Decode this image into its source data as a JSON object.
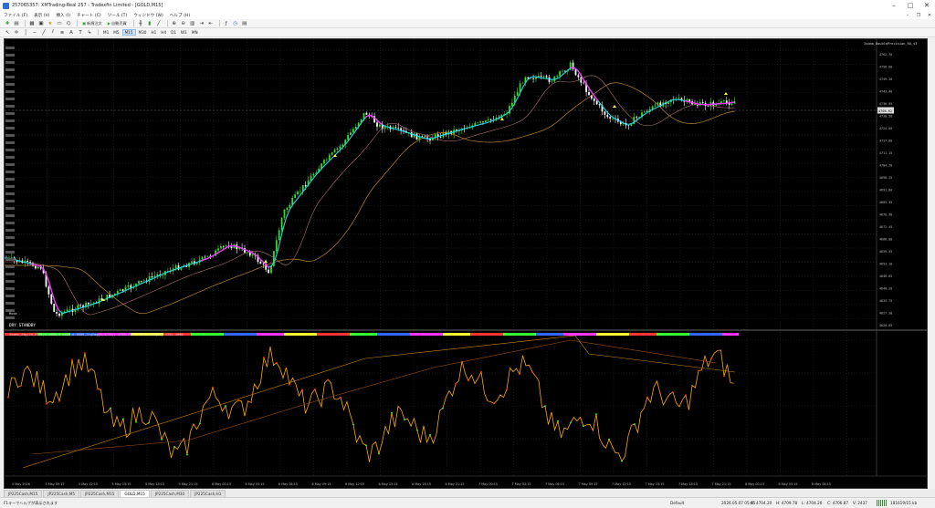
{
  "window": {
    "title": "257065357: XMTrading-Real 257 - Tradexfin Limited - [GOLD,M15]"
  },
  "menu": {
    "items": [
      "ファイル (F)",
      "表示 (V)",
      "挿入 (I)",
      "チャート (C)",
      "ツール (T)",
      "ウィンドウ (W)",
      "ヘルプ (H)"
    ]
  },
  "toolbar": {
    "new_order_label": "新規注文",
    "autotrade_label": "自動売買",
    "timeframes": [
      "M1",
      "M5",
      "M15",
      "M30",
      "H1",
      "H4",
      "D1",
      "W1",
      "MN"
    ],
    "active_timeframe": "M15"
  },
  "chart": {
    "indicator_name": "Ivoma_DoublePrecision_RA_v3",
    "sub_label": "DRY STANDBY",
    "mode_label": "Mode -",
    "lower_indicator": "Ivoma_Zag(20,0.01,0.0000,0.0000,0.0000,ZigZag(5,3,12)) 4733.7784 4758.1620(15) 4752.3990",
    "price_levels": [
      "4762.70",
      "4756.60",
      "4749.10",
      "4743.40",
      "4736.95",
      "4730.50",
      "4724.05",
      "4717.60",
      "4711.15",
      "4704.70",
      "4698.25",
      "4691.80",
      "4685.35",
      "4678.90",
      "4672.45",
      "4666.00",
      "4659.55",
      "4653.10",
      "4646.65",
      "4640.20",
      "4633.75",
      "4627.30",
      "4620.85"
    ],
    "current_price": "4705.62",
    "time_labels": [
      "5 May 2026",
      "5 May 09:15",
      "5 May 12:15",
      "5 May 15:15",
      "5 May 18:15",
      "5 May 21:15",
      "6 May 00:15",
      "6 May 03:15",
      "6 May 06:15",
      "6 May 09:15",
      "6 May 12:15",
      "6 May 15:15",
      "6 May 18:15",
      "6 May 21:15",
      "7 May 00:15",
      "7 May 03:15",
      "7 May 06:15",
      "7 May 09:15",
      "7 May 12:15",
      "7 May 15:15",
      "7 May 18:15",
      "7 May 21:15",
      "8 May 00:15",
      "8 May 03:15",
      "8 May 06:15"
    ],
    "colors": {
      "background": "#000000",
      "bull": "#33dd22",
      "bear": "#ffffff",
      "ma_fast": "#22d8e8",
      "ma_signal": "#ff33ff",
      "ma_slow": "#b8862b",
      "osc": "#ffaa00",
      "osc_dot_up": "#33ff33",
      "osc_dot_down": "#ff3311"
    }
  },
  "tabs": {
    "items": [
      "JP225Cash,M15",
      "JP225Cash,M5",
      "JP225Cash,M15",
      "GOLD,M15",
      "JP225Cash,M30",
      "JP225Cash,H1"
    ],
    "active_index": 3
  },
  "status": {
    "help_text": "F1キーでヘルプが表示されます",
    "profile": "Default",
    "datetime": "2026.05.07 05:45",
    "open": "O: 4704.20",
    "high": "H: 4709.78",
    "low": "L: 4704.20",
    "close": "C: 4706.87",
    "volume": "V: 2437",
    "connection": "181619/15 kb"
  }
}
